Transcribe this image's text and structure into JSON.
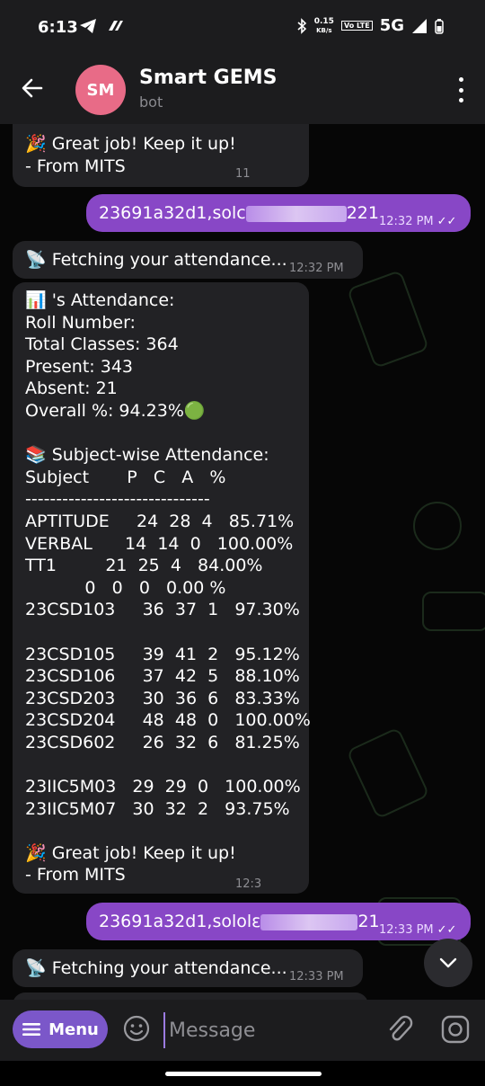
{
  "status_bar": {
    "time": "6:13",
    "net_speed_value": "0.15",
    "net_speed_unit": "KB/s",
    "volte": "Vo LTE",
    "network": "5G",
    "icons": [
      "telegram-icon",
      "share-icon",
      "bluetooth-icon",
      "signal-icon",
      "battery-icon"
    ]
  },
  "header": {
    "avatar_initials": "SM",
    "avatar_color": "#e86b87",
    "title": "Smart GEMS",
    "subtitle": "bot"
  },
  "messages": {
    "m1": {
      "text": "🎉 Great job! Keep it up!\n- From MITS",
      "time": "11"
    },
    "m2": {
      "text_start": "23691a32d1,solc",
      "text_end": "221",
      "time": "12:32 PM"
    },
    "m3": {
      "text": "📡 Fetching your attendance...",
      "time": "12:32 PM"
    },
    "m4": {
      "text": "📊 's Attendance:\nRoll Number:\nTotal Classes: 364\nPresent: 343\nAbsent: 21\nOverall %: 94.23%🟢\n\n📚 Subject-wise Attendance:\nSubject       P   C   A   %\n------------------------------\nAPTITUDE     24  28  4   85.71%\nVERBAL      14  14  0   100.00%\nTT1         21  25  4   84.00%\n           0   0   0   0.00 %\n23CSD103     36  37  1   97.30%\n\n23CSD105     39  41  2   95.12%\n23CSD106     37  42  5   88.10%\n23CSD203     30  36  6   83.33%\n23CSD204     48  48  0   100.00%\n23CSD602     26  32  6   81.25%\n\n23IIC5M03   29  29  0   100.00%\n23IIC5M07   30  32  2   93.75%\n\n🎉 Great job! Keep it up!\n- From MITS",
      "time": "12:3"
    },
    "m5": {
      "text_start": "23691a32d1,sololε",
      "text_end": "21",
      "time": "12:33 PM"
    },
    "m6": {
      "text": "📡 Fetching your attendance...",
      "time": "12:33 PM"
    }
  },
  "input_bar": {
    "menu_label": "Menu",
    "placeholder": "Message"
  },
  "colors": {
    "accent": "#7b57c9",
    "outgoing_bubble": "#8847c6",
    "incoming_bubble": "#222225",
    "background": "#060606"
  }
}
